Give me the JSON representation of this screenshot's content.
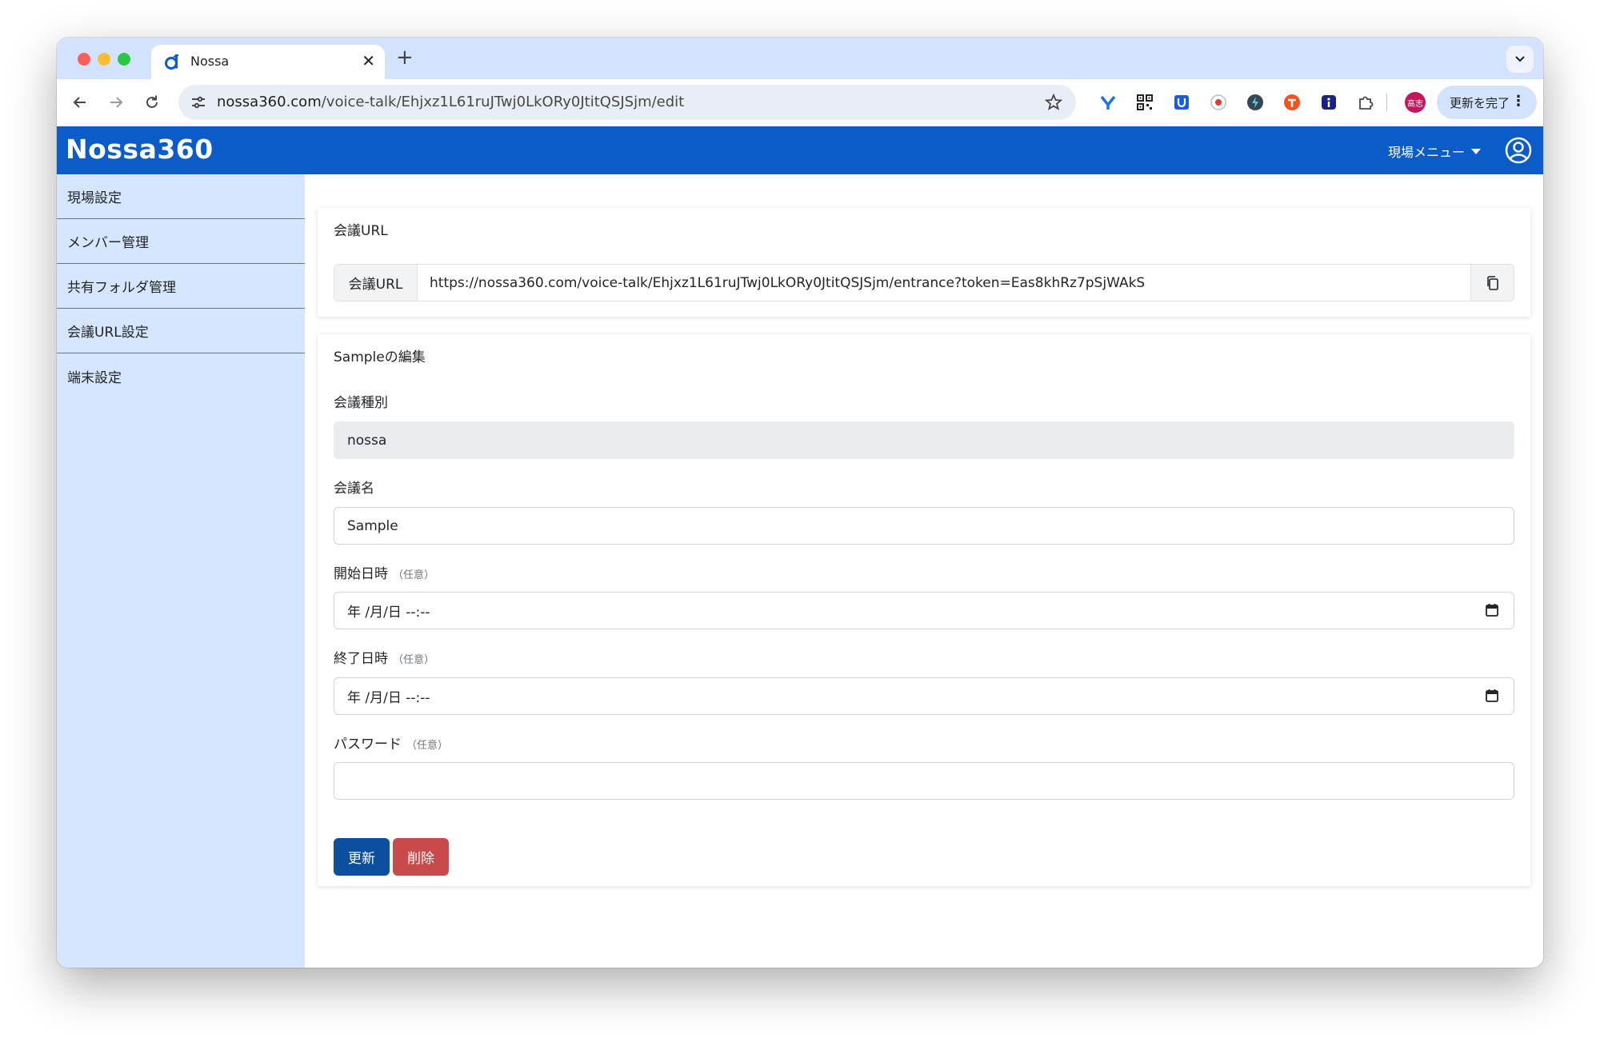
{
  "browser": {
    "tab_title": "Nossa",
    "url_host": "nossa360.com",
    "url_path": "/voice-talk/Ehjxz1L61ruJTwj0LkORy0JtitQSJSjm/edit",
    "profile_label": "高志",
    "update_label": "更新を完了"
  },
  "app": {
    "brand": "Nossa360",
    "site_menu_label": "現場メニュー"
  },
  "sidebar": {
    "items": [
      {
        "label": "現場設定"
      },
      {
        "label": "メンバー管理"
      },
      {
        "label": "共有フォルダ管理"
      },
      {
        "label": "会議URL設定"
      },
      {
        "label": "端末設定"
      }
    ]
  },
  "meeting_url_card": {
    "title": "会議URL",
    "label": "会議URL",
    "value": "https://nossa360.com/voice-talk/Ehjxz1L61ruJTwj0LkORy0JtitQSJSjm/entrance?token=Eas8khRz7pSjWAkS"
  },
  "edit_card": {
    "title": "Sampleの編集",
    "type_label": "会議種別",
    "type_value": "nossa",
    "name_label": "会議名",
    "name_value": "Sample",
    "start_label": "開始日時",
    "start_placeholder": "年 /月/日 --:--",
    "end_label": "終了日時",
    "end_placeholder": "年 /月/日 --:--",
    "password_label": "パスワード",
    "password_value": "",
    "optional": "（任意）",
    "update_button": "更新",
    "delete_button": "削除"
  },
  "colors": {
    "appbar": "#0b5bc9",
    "sidebar": "#d6e6fe",
    "update_button": "#0b4f9e",
    "delete_button": "#c84a4a"
  }
}
